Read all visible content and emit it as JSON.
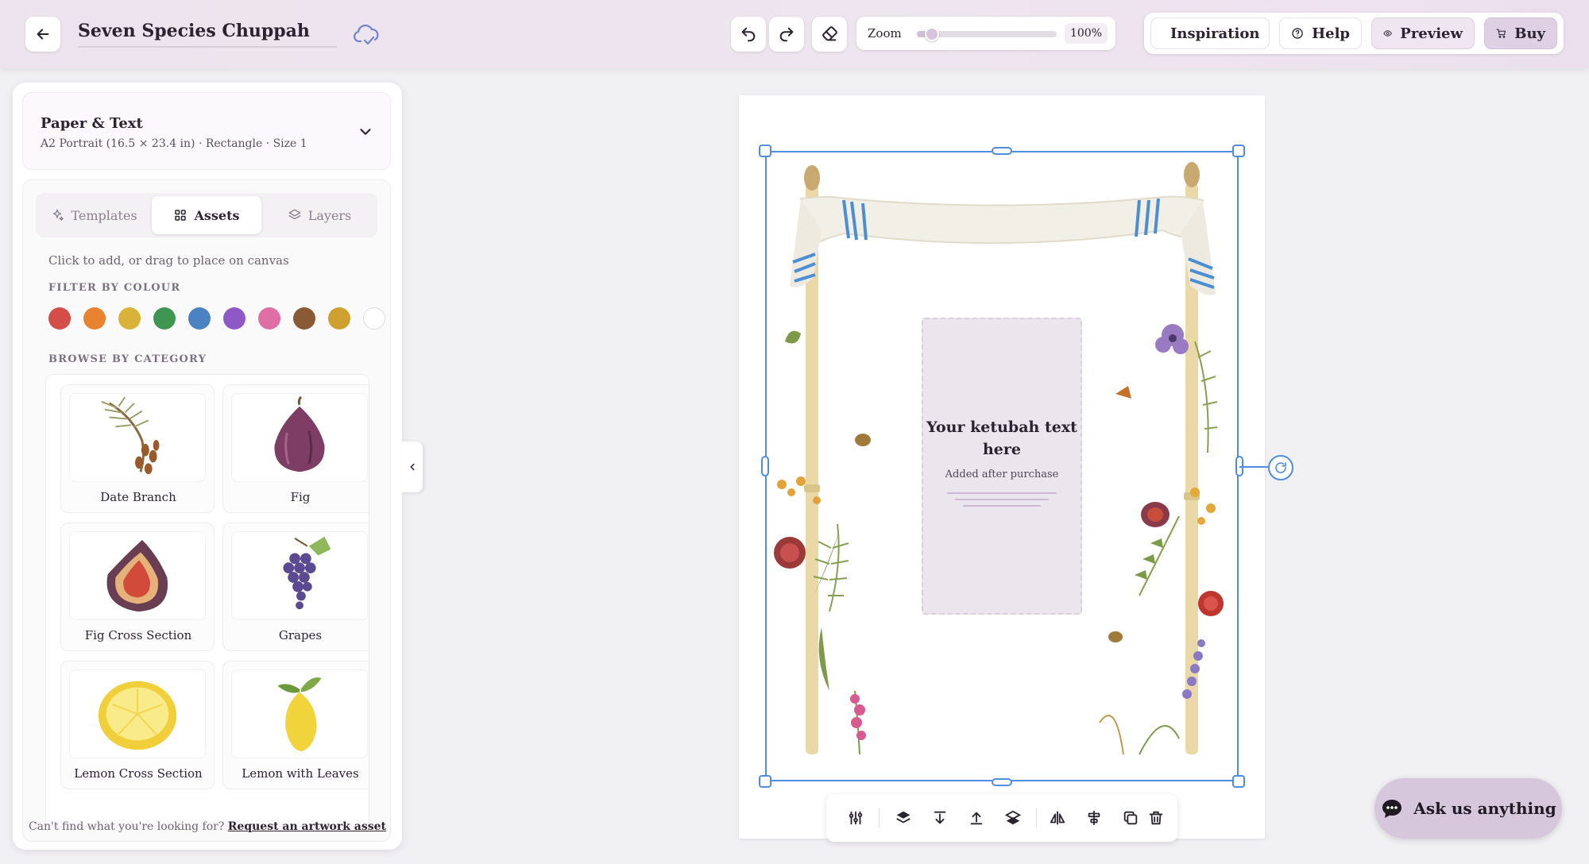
{
  "header": {
    "title": "Seven Species Chuppah",
    "zoom_label": "Zoom",
    "zoom_value": "100%",
    "zoom_level_percent": 100,
    "nav": {
      "inspiration": "Inspiration",
      "help": "Help",
      "preview": "Preview",
      "buy": "Buy"
    }
  },
  "sidebar": {
    "paper": {
      "title": "Paper & Text",
      "subtitle": "A2 Portrait (16.5 × 23.4 in) · Rectangle · Size 1"
    },
    "tabs": [
      {
        "label": "Templates",
        "icon": "sparkles-icon"
      },
      {
        "label": "Assets",
        "icon": "grid-icon",
        "active": true
      },
      {
        "label": "Layers",
        "icon": "layers-icon"
      }
    ],
    "hint": "Click to add, or drag to place on canvas",
    "filter_label": "FILTER BY COLOUR",
    "colours": [
      "#d44d49",
      "#e8822f",
      "#d9b23a",
      "#3f9651",
      "#4a82c4",
      "#8e59c6",
      "#de6ea4",
      "#8a5a36",
      "#cda02f",
      "#ffffff"
    ],
    "browse_label": "BROWSE BY CATEGORY",
    "assets": [
      {
        "name": "Date Branch"
      },
      {
        "name": "Fig"
      },
      {
        "name": "Fig Cross Section"
      },
      {
        "name": "Grapes"
      },
      {
        "name": "Lemon Cross Section"
      },
      {
        "name": "Lemon with Leaves"
      }
    ],
    "footer_prefix": "Can't find what you're looking for?",
    "footer_link": "Request an artwork asset"
  },
  "canvas": {
    "text_title": "Your ketubah text here",
    "text_subtitle": "Added after purchase"
  },
  "chat": {
    "label": "Ask us anything"
  },
  "colors": {
    "accent": "#4f8de0",
    "header_bg": "#ede3ee",
    "buy_bg": "#dfd0e4",
    "chat_bg": "#d7c7dd"
  }
}
